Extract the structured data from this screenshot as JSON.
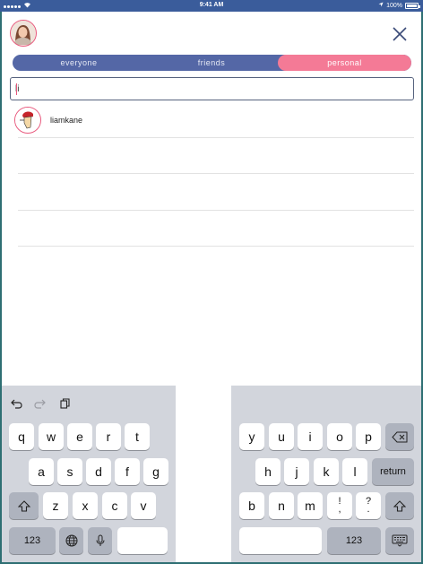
{
  "status_bar": {
    "time": "9:41 AM",
    "battery": "100%",
    "signal_dots": 5
  },
  "header": {
    "close_icon": "close-icon"
  },
  "tabs": [
    {
      "label": "everyone",
      "selected": false
    },
    {
      "label": "friends",
      "selected": false
    },
    {
      "label": "personal",
      "selected": true
    }
  ],
  "search": {
    "value": "li",
    "placeholder": ""
  },
  "results": [
    {
      "name": "liamkane"
    }
  ],
  "colors": {
    "brand_blue": "#5467a6",
    "accent_pink": "#f47a96",
    "status_bar": "#3a5c9b",
    "keyboard_bg": "#d2d5dc"
  },
  "keyboard": {
    "left_toolbar": [
      "undo-icon",
      "redo-icon",
      "paste-icon"
    ],
    "left_row1": [
      "q",
      "w",
      "e",
      "r",
      "t"
    ],
    "left_row2": [
      "a",
      "s",
      "d",
      "f",
      "g"
    ],
    "left_row3": [
      "z",
      "x",
      "c",
      "v"
    ],
    "right_row1": [
      "y",
      "u",
      "i",
      "o",
      "p"
    ],
    "right_row2": [
      "h",
      "j",
      "k",
      "l"
    ],
    "right_row3": [
      "b",
      "n",
      "m"
    ],
    "punct1": {
      "top": "!",
      "bottom": ","
    },
    "punct2": {
      "top": "?",
      "bottom": "."
    },
    "return_label": "return",
    "numbers_label": "123"
  }
}
